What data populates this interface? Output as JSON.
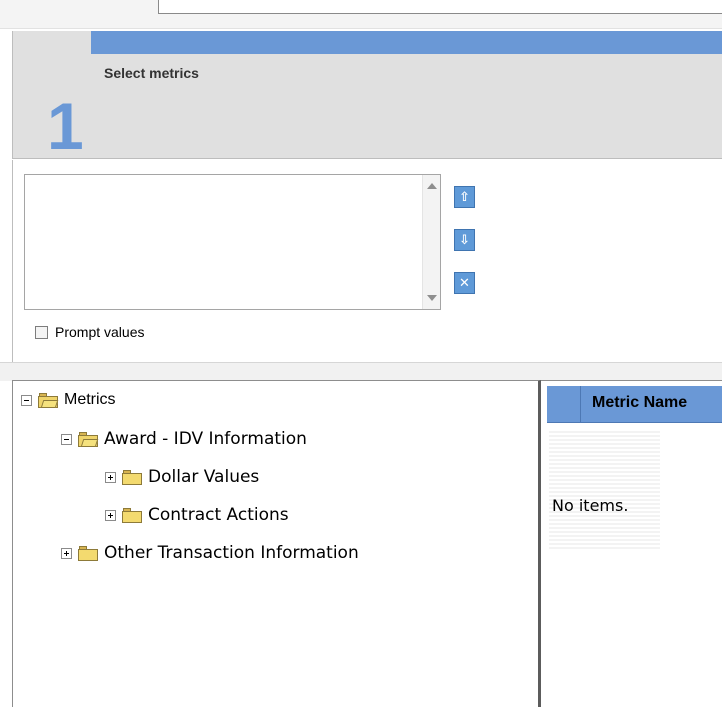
{
  "header": {
    "step_number": "1",
    "step_title": "Select metrics"
  },
  "selection": {
    "prompt_label": "Prompt values",
    "buttons": [
      {
        "name": "move-top",
        "icon": "double-chevron-up-icon"
      },
      {
        "name": "move-bottom",
        "icon": "double-chevron-down-icon"
      },
      {
        "name": "remove",
        "icon": "close-icon"
      }
    ]
  },
  "tree": {
    "items": [
      {
        "label": "Metrics",
        "expanded": true
      },
      {
        "label": "Award - IDV Information",
        "expanded": true
      },
      {
        "label": "Dollar Values",
        "expanded": false
      },
      {
        "label": "Contract Actions",
        "expanded": false
      },
      {
        "label": "Other Transaction Information",
        "expanded": false
      }
    ]
  },
  "table": {
    "header": "Metric Name",
    "empty_message": "No items."
  },
  "colors": {
    "accent_blue": "#6a98d6",
    "panel_gray": "#e0e0e0"
  }
}
